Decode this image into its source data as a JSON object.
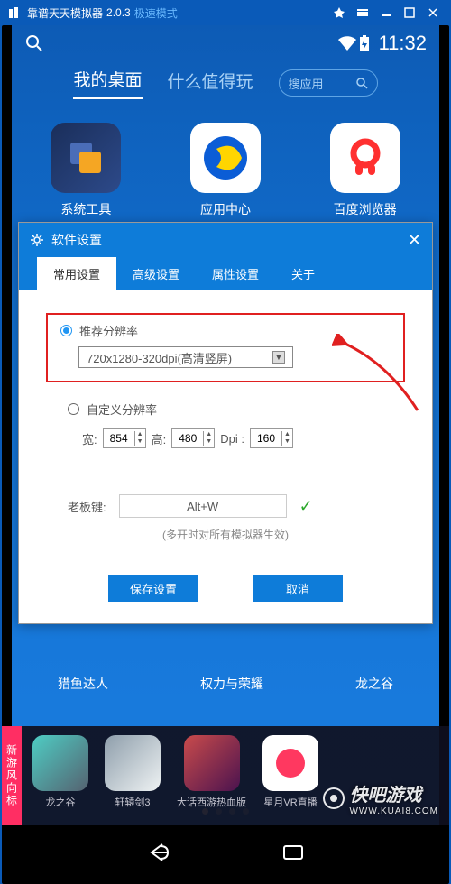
{
  "titlebar": {
    "name": "靠谱天天模拟器",
    "version": "2.0.3",
    "mode": "极速模式"
  },
  "statusbar": {
    "time": "11:32"
  },
  "navtabs": {
    "tab1": "我的桌面",
    "tab2": "什么值得玩",
    "search_placeholder": "搜应用"
  },
  "apps": {
    "a1": "系统工具",
    "a2": "应用中心",
    "a3": "百度浏览器",
    "r2a": "猎鱼达人",
    "r2b": "权力与荣耀",
    "r2c": "龙之谷"
  },
  "dialog": {
    "title": "软件设置",
    "tabs": {
      "t1": "常用设置",
      "t2": "高级设置",
      "t3": "属性设置",
      "t4": "关于"
    },
    "recommend_label": "推荐分辨率",
    "recommend_value": "720x1280-320dpi(高清竖屏)",
    "custom_label": "自定义分辨率",
    "width_label": "宽:",
    "width_val": "854",
    "height_label": "高:",
    "height_val": "480",
    "dpi_label": "Dpi :",
    "dpi_val": "160",
    "hotkey_label": "老板键:",
    "hotkey_value": "Alt+W",
    "hotkey_note": "(多开时对所有模拟器生效)",
    "save": "保存设置",
    "cancel": "取消"
  },
  "bottombar": {
    "tag": "新游风向标",
    "g1": "龙之谷",
    "g2": "轩辕剑3",
    "g3": "大话西游热血版",
    "g4": "星月VR直播"
  },
  "watermark": {
    "main": "快吧游戏",
    "sub": "WWW.KUAI8.COM"
  }
}
